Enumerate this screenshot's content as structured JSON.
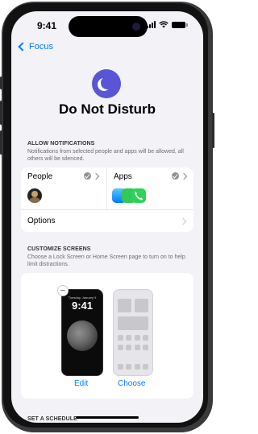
{
  "status": {
    "time": "9:41"
  },
  "nav": {
    "back_label": "Focus"
  },
  "header": {
    "title": "Do Not Disturb"
  },
  "allow": {
    "heading": "ALLOW NOTIFICATIONS",
    "description": "Notifications from selected people and apps will be allowed, all others will be silenced.",
    "people_label": "People",
    "apps_label": "Apps",
    "options_label": "Options"
  },
  "customize": {
    "heading": "CUSTOMIZE SCREENS",
    "description": "Choose a Lock Screen or Home Screen page to turn on to help limit distractions.",
    "lock_date": "Tuesday, January 9",
    "lock_time": "9:41",
    "edit_label": "Edit",
    "choose_label": "Choose"
  },
  "schedule": {
    "heading": "SET A SCHEDULE"
  },
  "colors": {
    "accent": "#007aff",
    "focus_purple": "#5856d6"
  }
}
